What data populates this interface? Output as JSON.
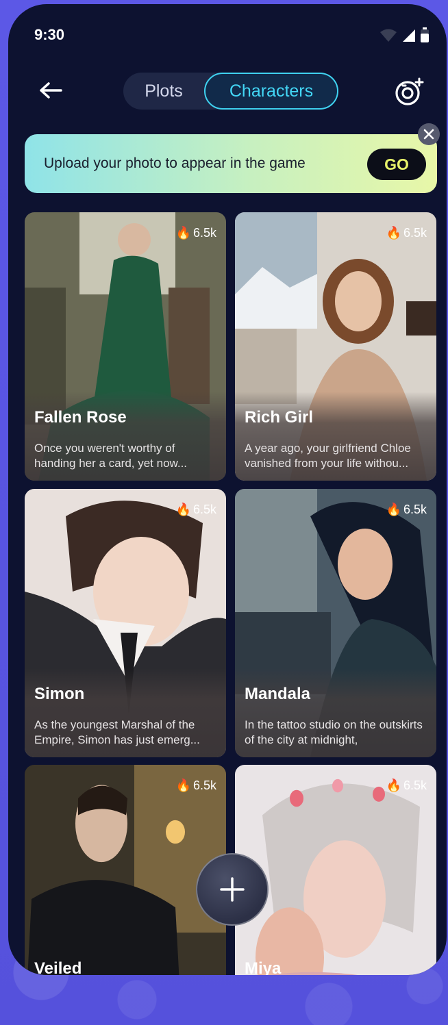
{
  "status": {
    "time": "9:30"
  },
  "header": {
    "tabs": [
      {
        "label": "Plots",
        "active": false
      },
      {
        "label": "Characters",
        "active": true
      }
    ]
  },
  "banner": {
    "text": "Upload your photo to appear in the game",
    "button_label": "GO"
  },
  "cards": [
    {
      "name": "Fallen Rose",
      "popularity": "6.5k",
      "description": "Once you weren't worthy of handing her a card, yet now..."
    },
    {
      "name": "Rich Girl",
      "popularity": "6.5k",
      "description": "A year ago, your girlfriend Chloe vanished from your life withou..."
    },
    {
      "name": "Simon",
      "popularity": "6.5k",
      "description": "As the youngest Marshal of the Empire, Simon has just emerg..."
    },
    {
      "name": "Mandala",
      "popularity": "6.5k",
      "description": "In the tattoo studio on the outskirts of the city at midnight,"
    },
    {
      "name": "Veiled",
      "popularity": "6.5k",
      "description": ""
    },
    {
      "name": "Miya",
      "popularity": "6.5k",
      "description": ""
    }
  ],
  "icons": {
    "back": "arrow-left-icon",
    "camera": "camera-plus-icon",
    "close": "close-icon",
    "fire": "fire-icon",
    "add": "plus-icon"
  },
  "colors": {
    "accent": "#43d6f5",
    "background": "#0d1230",
    "frame": "#5b57e0",
    "go_text": "#e8f36a"
  }
}
